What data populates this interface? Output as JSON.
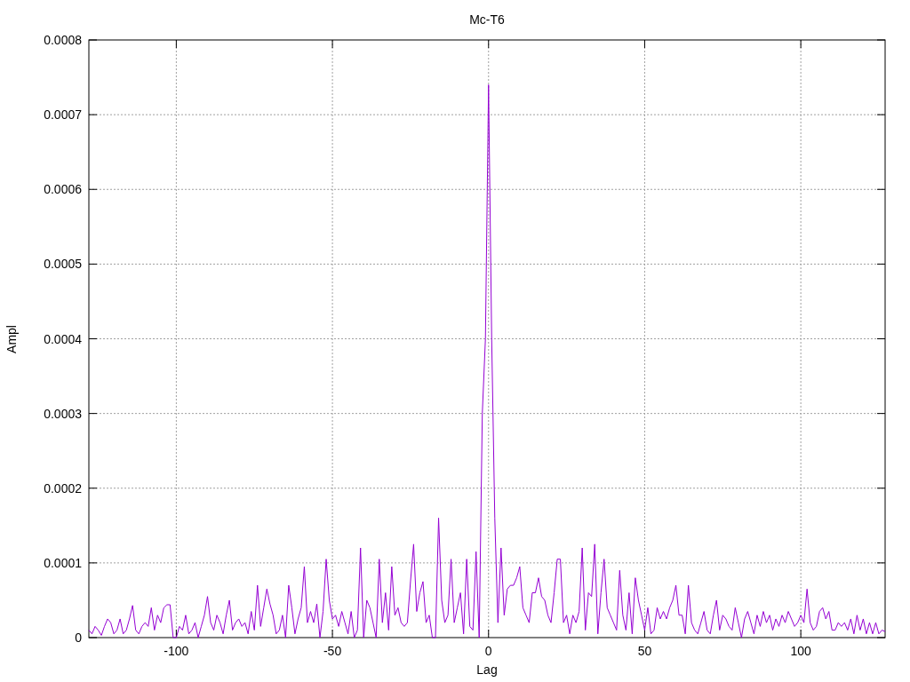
{
  "chart_data": {
    "type": "line",
    "title": "Mc-T6",
    "xlabel": "Lag",
    "grid": true,
    "ylabel": "Ampl",
    "xlim": [
      -128,
      127
    ],
    "ylim": [
      0,
      0.0008
    ],
    "xticks": [
      -100,
      -50,
      0,
      50,
      100
    ],
    "yticks": [
      0,
      0.0001,
      0.0002,
      0.0003,
      0.0004,
      0.0005,
      0.0006,
      0.0007,
      0.0008
    ],
    "x": [
      -128,
      -127,
      -126,
      -125,
      -124,
      -123,
      -122,
      -121,
      -120,
      -119,
      -118,
      -117,
      -116,
      -115,
      -114,
      -113,
      -112,
      -111,
      -110,
      -109,
      -108,
      -107,
      -106,
      -105,
      -104,
      -103,
      -102,
      -101,
      -100,
      -99,
      -98,
      -97,
      -96,
      -95,
      -94,
      -93,
      -92,
      -91,
      -90,
      -89,
      -88,
      -87,
      -86,
      -85,
      -84,
      -83,
      -82,
      -81,
      -80,
      -79,
      -78,
      -77,
      -76,
      -75,
      -74,
      -73,
      -72,
      -71,
      -70,
      -69,
      -68,
      -67,
      -66,
      -65,
      -64,
      -63,
      -62,
      -61,
      -60,
      -59,
      -58,
      -57,
      -56,
      -55,
      -54,
      -53,
      -52,
      -51,
      -50,
      -49,
      -48,
      -47,
      -46,
      -45,
      -44,
      -43,
      -42,
      -41,
      -40,
      -39,
      -38,
      -37,
      -36,
      -35,
      -34,
      -33,
      -32,
      -31,
      -30,
      -29,
      -28,
      -27,
      -26,
      -25,
      -24,
      -23,
      -22,
      -21,
      -20,
      -19,
      -18,
      -17,
      -16,
      -15,
      -14,
      -13,
      -12,
      -11,
      -10,
      -9,
      -8,
      -7,
      -6,
      -5,
      -4,
      -3,
      -2,
      -1,
      0,
      1,
      2,
      3,
      4,
      5,
      6,
      7,
      8,
      9,
      10,
      11,
      12,
      13,
      14,
      15,
      16,
      17,
      18,
      19,
      20,
      21,
      22,
      23,
      24,
      25,
      26,
      27,
      28,
      29,
      30,
      31,
      32,
      33,
      34,
      35,
      36,
      37,
      38,
      39,
      40,
      41,
      42,
      43,
      44,
      45,
      46,
      47,
      48,
      49,
      50,
      51,
      52,
      53,
      54,
      55,
      56,
      57,
      58,
      59,
      60,
      61,
      62,
      63,
      64,
      65,
      66,
      67,
      68,
      69,
      70,
      71,
      72,
      73,
      74,
      75,
      76,
      77,
      78,
      79,
      80,
      81,
      82,
      83,
      84,
      85,
      86,
      87,
      88,
      89,
      90,
      91,
      92,
      93,
      94,
      95,
      96,
      97,
      98,
      99,
      100,
      101,
      102,
      103,
      104,
      105,
      106,
      107,
      108,
      109,
      110,
      111,
      112,
      113,
      114,
      115,
      116,
      117,
      118,
      119,
      120,
      121,
      122,
      123,
      124,
      125,
      126,
      127
    ],
    "series": [
      {
        "color": "#9400d3",
        "values": [
          1e-05,
          5e-06,
          1.5e-05,
          1e-05,
          3e-06,
          1.5e-05,
          2.5e-05,
          2e-05,
          5e-06,
          1e-05,
          2.5e-05,
          5e-06,
          1e-05,
          2.5e-05,
          4.3e-05,
          1e-05,
          5e-06,
          1.5e-05,
          2e-05,
          1.5e-05,
          4e-05,
          1e-05,
          3e-05,
          2e-05,
          4e-05,
          4.4e-05,
          4.4e-05,
          0,
          0,
          1.5e-05,
          1e-05,
          3e-05,
          5e-06,
          1e-05,
          2e-05,
          0,
          1.5e-05,
          3e-05,
          5.5e-05,
          2e-05,
          1e-05,
          3e-05,
          2e-05,
          5e-06,
          3e-05,
          5e-05,
          1e-05,
          2e-05,
          2.5e-05,
          1.5e-05,
          2e-05,
          5e-06,
          3.5e-05,
          1e-05,
          7e-05,
          1.5e-05,
          4e-05,
          6.5e-05,
          4.5e-05,
          3e-05,
          5e-06,
          1e-05,
          3e-05,
          0,
          7e-05,
          4e-05,
          5e-06,
          2.5e-05,
          4e-05,
          9.5e-05,
          2e-05,
          3.5e-05,
          2e-05,
          4.5e-05,
          0,
          3.5e-05,
          0.000105,
          5e-05,
          2.5e-05,
          3e-05,
          1.5e-05,
          3.5e-05,
          2e-05,
          5e-06,
          3.5e-05,
          0,
          1e-05,
          0.00012,
          0,
          5e-05,
          4e-05,
          2e-05,
          0,
          0.000105,
          2e-05,
          6e-05,
          1e-05,
          9.5e-05,
          3e-05,
          4e-05,
          2e-05,
          1.5e-05,
          2e-05,
          7.5e-05,
          0.000125,
          3.5e-05,
          6e-05,
          7.5e-05,
          2e-05,
          3e-05,
          0,
          0,
          0.00016,
          5e-05,
          2e-05,
          3e-05,
          0.000105,
          2e-05,
          4e-05,
          6e-05,
          5e-06,
          0.000105,
          1.5e-05,
          1e-05,
          0.000115,
          0,
          0.0003,
          0.0004,
          0.00074,
          0.0004,
          0.00016,
          2e-05,
          0.00012,
          3e-05,
          6.5e-05,
          7e-05,
          7e-05,
          8e-05,
          9.5e-05,
          4e-05,
          3e-05,
          2e-05,
          6e-05,
          6e-05,
          8e-05,
          5.5e-05,
          5e-05,
          3e-05,
          2e-05,
          6e-05,
          0.000105,
          0.000105,
          2e-05,
          3e-05,
          5e-06,
          3e-05,
          2e-05,
          3.5e-05,
          0.00012,
          1e-05,
          6e-05,
          5.5e-05,
          0.000125,
          5e-06,
          6e-05,
          0.000105,
          4e-05,
          3e-05,
          2e-05,
          1e-05,
          9e-05,
          3e-05,
          1e-05,
          6e-05,
          5e-06,
          8e-05,
          5e-05,
          3e-05,
          1e-05,
          4e-05,
          5e-06,
          1e-05,
          4e-05,
          2.5e-05,
          3.5e-05,
          2.5e-05,
          4e-05,
          5e-05,
          7e-05,
          3e-05,
          3e-05,
          5e-06,
          7e-05,
          2e-05,
          1e-05,
          5e-06,
          2e-05,
          3.5e-05,
          1e-05,
          5e-06,
          3e-05,
          5e-05,
          1e-05,
          3e-05,
          2.5e-05,
          1.5e-05,
          1e-05,
          4e-05,
          2e-05,
          0,
          2.5e-05,
          3.5e-05,
          2e-05,
          5e-06,
          3e-05,
          1.5e-05,
          3.5e-05,
          2e-05,
          3e-05,
          1e-05,
          2.5e-05,
          1.5e-05,
          3e-05,
          2e-05,
          3.5e-05,
          2.5e-05,
          1.5e-05,
          2e-05,
          3e-05,
          2e-05,
          6.5e-05,
          2e-05,
          1e-05,
          1.5e-05,
          3.5e-05,
          4e-05,
          2.5e-05,
          3.5e-05,
          1e-05,
          1e-05,
          2e-05,
          1.5e-05,
          2e-05,
          1e-05,
          2.5e-05,
          5e-06,
          3e-05,
          1e-05,
          2.5e-05,
          5e-06,
          2e-05,
          5e-06,
          2e-05,
          5e-06,
          1e-05,
          8e-06
        ]
      }
    ]
  }
}
